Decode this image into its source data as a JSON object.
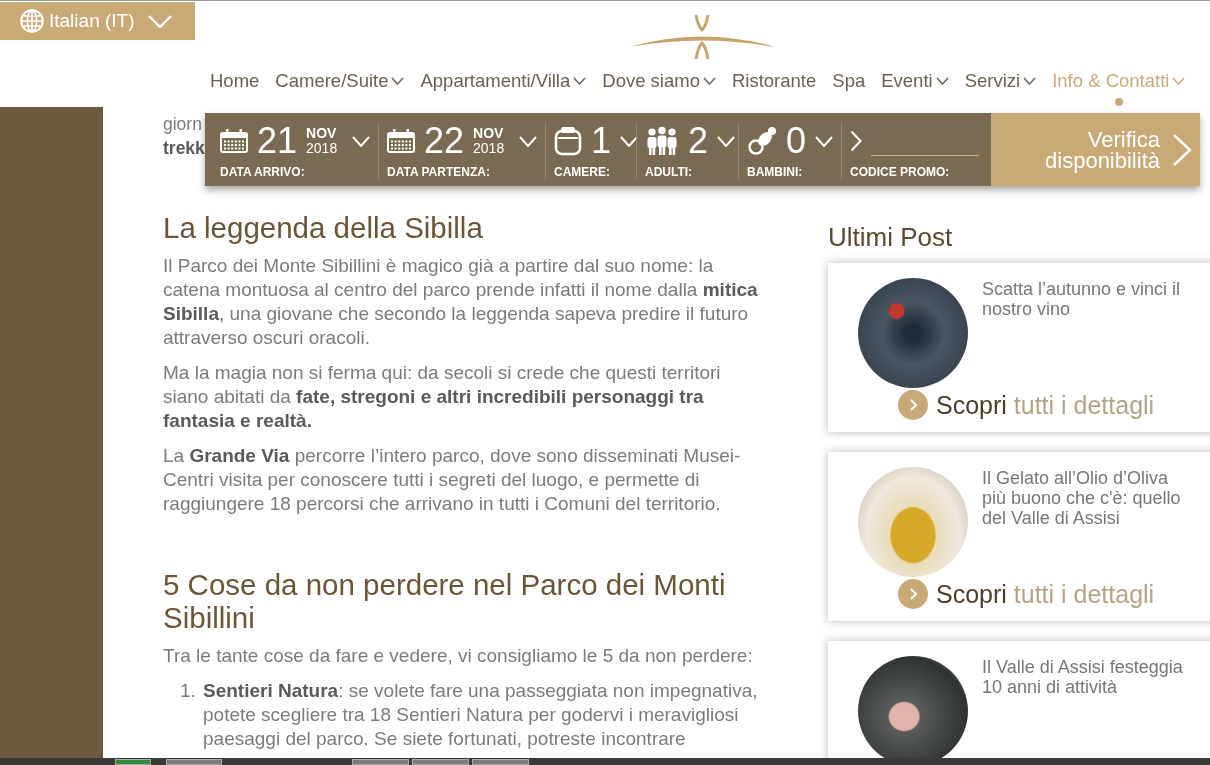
{
  "language_selector": {
    "label": "Italian (IT)"
  },
  "nav": {
    "items": [
      {
        "label": "Home",
        "dropdown": false,
        "selected": false
      },
      {
        "label": "Camere/Suite",
        "dropdown": true,
        "selected": false
      },
      {
        "label": "Appartamenti/Villa",
        "dropdown": true,
        "selected": false
      },
      {
        "label": "Dove siamo",
        "dropdown": true,
        "selected": false
      },
      {
        "label": "Ristorante",
        "dropdown": false,
        "selected": false
      },
      {
        "label": "Spa",
        "dropdown": false,
        "selected": false
      },
      {
        "label": "Eventi",
        "dropdown": true,
        "selected": false
      },
      {
        "label": "Servizi",
        "dropdown": true,
        "selected": false
      },
      {
        "label": "Info & Contatti",
        "dropdown": true,
        "selected": true
      }
    ]
  },
  "booking_bar": {
    "fields": [
      {
        "kind": "date",
        "day": "21",
        "month": "NOV",
        "year": "2018",
        "label": "DATA ARRIVO:"
      },
      {
        "kind": "date",
        "day": "22",
        "month": "NOV",
        "year": "2018",
        "label": "DATA PARTENZA:"
      },
      {
        "kind": "rooms",
        "value": "1",
        "label": "CAMERE:"
      },
      {
        "kind": "adults",
        "value": "2",
        "label": "ADULTI:"
      },
      {
        "kind": "children",
        "value": "0",
        "label": "BAMBINI:"
      },
      {
        "kind": "promo",
        "label": "CODICE PROMO:"
      }
    ],
    "button": "Verifica disponibilità"
  },
  "article": {
    "covered_lines": [
      {
        "text": "giorn",
        "bold": false
      },
      {
        "text": "trekk",
        "bold": true
      }
    ],
    "sections": [
      {
        "heading": "La leggenda della Sibilla",
        "paragraphs": [
          "Il Parco dei Monte Sibillini è magico già a partire dal suo nome: la catena montuosa al centro del parco prende infatti il nome dalla **mitica Sibilla**, una giovane che secondo la leggenda sapeva predire il futuro attraverso oscuri oracoli.",
          "Ma la magia non si ferma qui: da secoli si crede che questi territori siano abitati da **fate, stregoni e altri incredibili personaggi tra fantasia e realtà.**",
          "La **Grande Via** percorre l’intero parco, dove sono disseminati Musei-Centri visita per conoscere tutti i segreti del luogo, e permette di raggiungere 18 percorsi che arrivano in tutti i Comuni del territorio."
        ]
      },
      {
        "heading": "5 Cose da non perdere nel Parco dei Monti Sibillini",
        "paragraphs": [
          "Tra le tante cose da fare e vedere, vi consigliamo le 5 da non perdere:"
        ],
        "list": [
          {
            "number": "1.",
            "text": "**Sentieri Natura**: se volete fare una passeggiata non impegnativa, potete scegliere tra 18 Sentieri Natura per godervi i meravigliosi paesaggi del parco. Se siete fortunati, potreste incontrare"
          }
        ]
      }
    ]
  },
  "sidebar": {
    "title": "Ultimi Post",
    "posts": [
      {
        "title": "Scatta l’autunno e vinci il nostro vino",
        "link": "**Scopri** tutti i dettagli"
      },
      {
        "title": "Il Gelato all’Olio d’Oliva più buono che c'è: quello del Valle di Assisi",
        "link": "**Scopri** tutti i dettagli"
      },
      {
        "title": "Il Valle di Assisi festeggia 10 anni di attività"
      }
    ]
  }
}
